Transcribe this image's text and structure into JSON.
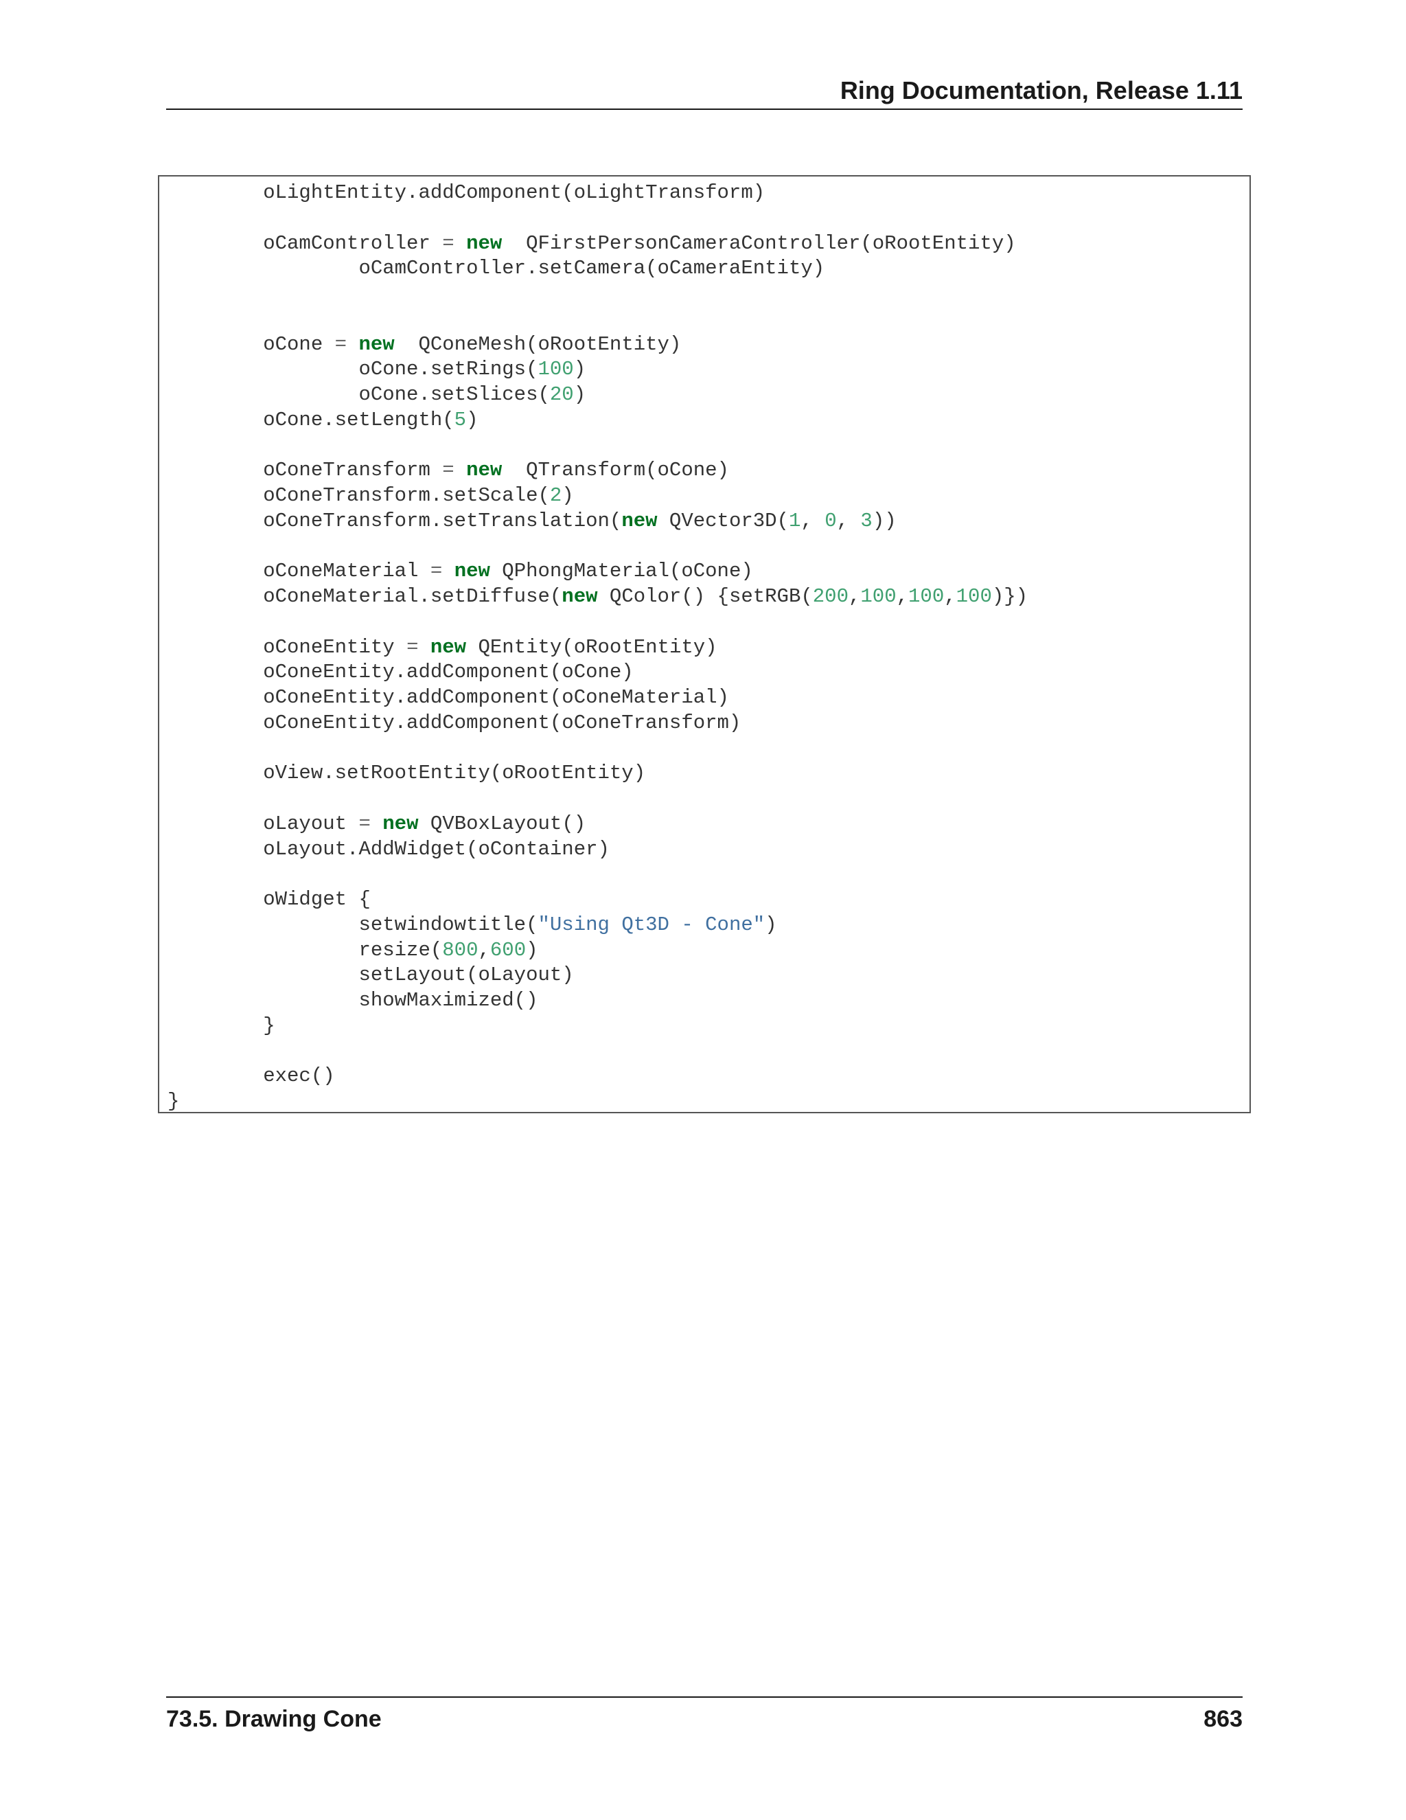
{
  "header": {
    "title": "Ring Documentation, Release 1.11"
  },
  "code": {
    "lines": [
      [
        {
          "t": "        oLightEntity.addComponent(oLightTransform)",
          "c": ""
        }
      ],
      [
        {
          "t": "",
          "c": ""
        }
      ],
      [
        {
          "t": "        oCamController ",
          "c": ""
        },
        {
          "t": "=",
          "c": "op"
        },
        {
          "t": " ",
          "c": ""
        },
        {
          "t": "new",
          "c": "kw"
        },
        {
          "t": "  QFirstPersonCameraController(oRootEntity)",
          "c": ""
        }
      ],
      [
        {
          "t": "                oCamController.setCamera(oCameraEntity)",
          "c": ""
        }
      ],
      [
        {
          "t": "",
          "c": ""
        }
      ],
      [
        {
          "t": "",
          "c": ""
        }
      ],
      [
        {
          "t": "        oCone ",
          "c": ""
        },
        {
          "t": "=",
          "c": "op"
        },
        {
          "t": " ",
          "c": ""
        },
        {
          "t": "new",
          "c": "kw"
        },
        {
          "t": "  QConeMesh(oRootEntity)",
          "c": ""
        }
      ],
      [
        {
          "t": "                oCone.setRings(",
          "c": ""
        },
        {
          "t": "100",
          "c": "num"
        },
        {
          "t": ")",
          "c": ""
        }
      ],
      [
        {
          "t": "                oCone.setSlices(",
          "c": ""
        },
        {
          "t": "20",
          "c": "num"
        },
        {
          "t": ")",
          "c": ""
        }
      ],
      [
        {
          "t": "        oCone.setLength(",
          "c": ""
        },
        {
          "t": "5",
          "c": "num"
        },
        {
          "t": ")",
          "c": ""
        }
      ],
      [
        {
          "t": "",
          "c": ""
        }
      ],
      [
        {
          "t": "        oConeTransform ",
          "c": ""
        },
        {
          "t": "=",
          "c": "op"
        },
        {
          "t": " ",
          "c": ""
        },
        {
          "t": "new",
          "c": "kw"
        },
        {
          "t": "  QTransform(oCone)",
          "c": ""
        }
      ],
      [
        {
          "t": "        oConeTransform.setScale(",
          "c": ""
        },
        {
          "t": "2",
          "c": "num"
        },
        {
          "t": ")",
          "c": ""
        }
      ],
      [
        {
          "t": "        oConeTransform.setTranslation(",
          "c": ""
        },
        {
          "t": "new",
          "c": "kw"
        },
        {
          "t": " QVector3D(",
          "c": ""
        },
        {
          "t": "1",
          "c": "num"
        },
        {
          "t": ", ",
          "c": ""
        },
        {
          "t": "0",
          "c": "num"
        },
        {
          "t": ", ",
          "c": ""
        },
        {
          "t": "3",
          "c": "num"
        },
        {
          "t": "))",
          "c": ""
        }
      ],
      [
        {
          "t": "",
          "c": ""
        }
      ],
      [
        {
          "t": "        oConeMaterial ",
          "c": ""
        },
        {
          "t": "=",
          "c": "op"
        },
        {
          "t": " ",
          "c": ""
        },
        {
          "t": "new",
          "c": "kw"
        },
        {
          "t": " QPhongMaterial(oCone)",
          "c": ""
        }
      ],
      [
        {
          "t": "        oConeMaterial.setDiffuse(",
          "c": ""
        },
        {
          "t": "new",
          "c": "kw"
        },
        {
          "t": " QColor() {setRGB(",
          "c": ""
        },
        {
          "t": "200",
          "c": "num"
        },
        {
          "t": ",",
          "c": ""
        },
        {
          "t": "100",
          "c": "num"
        },
        {
          "t": ",",
          "c": ""
        },
        {
          "t": "100",
          "c": "num"
        },
        {
          "t": ",",
          "c": ""
        },
        {
          "t": "100",
          "c": "num"
        },
        {
          "t": ")})",
          "c": ""
        }
      ],
      [
        {
          "t": "",
          "c": ""
        }
      ],
      [
        {
          "t": "        oConeEntity ",
          "c": ""
        },
        {
          "t": "=",
          "c": "op"
        },
        {
          "t": " ",
          "c": ""
        },
        {
          "t": "new",
          "c": "kw"
        },
        {
          "t": " QEntity(oRootEntity)",
          "c": ""
        }
      ],
      [
        {
          "t": "        oConeEntity.addComponent(oCone)",
          "c": ""
        }
      ],
      [
        {
          "t": "        oConeEntity.addComponent(oConeMaterial)",
          "c": ""
        }
      ],
      [
        {
          "t": "        oConeEntity.addComponent(oConeTransform)",
          "c": ""
        }
      ],
      [
        {
          "t": "",
          "c": ""
        }
      ],
      [
        {
          "t": "        oView.setRootEntity(oRootEntity)",
          "c": ""
        }
      ],
      [
        {
          "t": "",
          "c": ""
        }
      ],
      [
        {
          "t": "        oLayout ",
          "c": ""
        },
        {
          "t": "=",
          "c": "op"
        },
        {
          "t": " ",
          "c": ""
        },
        {
          "t": "new",
          "c": "kw"
        },
        {
          "t": " QVBoxLayout()",
          "c": ""
        }
      ],
      [
        {
          "t": "        oLayout.AddWidget(oContainer)",
          "c": ""
        }
      ],
      [
        {
          "t": "",
          "c": ""
        }
      ],
      [
        {
          "t": "        oWidget {",
          "c": ""
        }
      ],
      [
        {
          "t": "                setwindowtitle(",
          "c": ""
        },
        {
          "t": "\"Using Qt3D - Cone\"",
          "c": "str"
        },
        {
          "t": ")",
          "c": ""
        }
      ],
      [
        {
          "t": "                resize(",
          "c": ""
        },
        {
          "t": "800",
          "c": "num"
        },
        {
          "t": ",",
          "c": ""
        },
        {
          "t": "600",
          "c": "num"
        },
        {
          "t": ")",
          "c": ""
        }
      ],
      [
        {
          "t": "                setLayout(oLayout)",
          "c": ""
        }
      ],
      [
        {
          "t": "                showMaximized()",
          "c": ""
        }
      ],
      [
        {
          "t": "        }",
          "c": ""
        }
      ],
      [
        {
          "t": "",
          "c": ""
        }
      ],
      [
        {
          "t": "        exec()",
          "c": ""
        }
      ],
      [
        {
          "t": "}",
          "c": ""
        }
      ]
    ]
  },
  "footer": {
    "section": "73.5.  Drawing Cone",
    "page_number": "863"
  },
  "colors": {
    "keyword": "#007020",
    "number": "#40a070",
    "string": "#4070a0",
    "text": "#333333"
  }
}
